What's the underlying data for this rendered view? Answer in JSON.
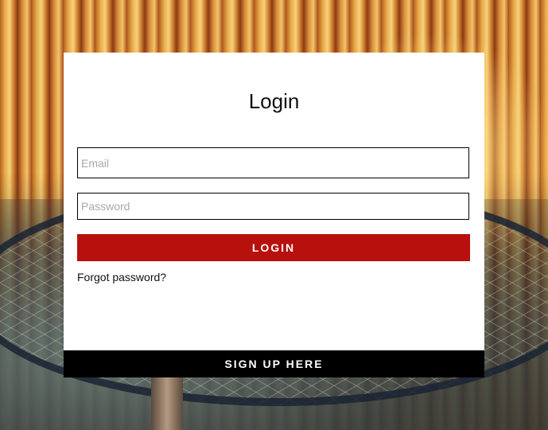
{
  "login_form": {
    "title": "Login",
    "email_placeholder": "Email",
    "email_value": "",
    "password_placeholder": "Password",
    "password_value": "",
    "login_button_label": "LOGIN",
    "forgot_password_label": "Forgot password?",
    "signup_label": "SIGN UP HERE"
  },
  "colors": {
    "card_background": "#ffffff",
    "login_button": "#b7100d",
    "signup_bar": "#000000",
    "field_border": "#000000",
    "placeholder_text": "#a8a8a8"
  }
}
